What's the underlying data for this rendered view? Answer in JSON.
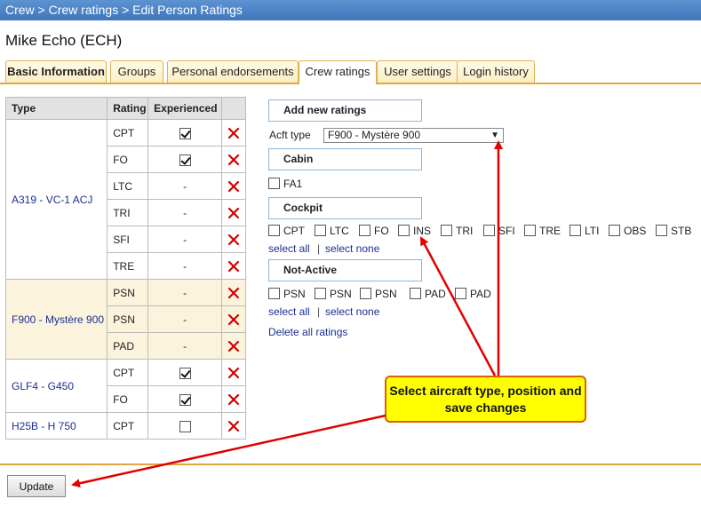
{
  "breadcrumb": "Crew > Crew ratings > Edit Person Ratings",
  "person_name": "Mike Echo (ECH)",
  "tabs": [
    {
      "label": "Basic Information",
      "active": false
    },
    {
      "label": "Groups",
      "active": false
    },
    {
      "label": "Personal endorsements",
      "active": false
    },
    {
      "label": "Crew ratings",
      "active": true
    },
    {
      "label": "User settings",
      "active": false
    },
    {
      "label": "Login history",
      "active": false
    }
  ],
  "ratings_table": {
    "headers": [
      "Type",
      "Rating",
      "Experienced",
      ""
    ],
    "groups": [
      {
        "type": "A319 - VC-1 ACJ",
        "rows": [
          {
            "rating": "CPT",
            "experienced": "checked"
          },
          {
            "rating": "FO",
            "experienced": "checked"
          },
          {
            "rating": "LTC",
            "experienced": "-"
          },
          {
            "rating": "TRI",
            "experienced": "-"
          },
          {
            "rating": "SFI",
            "experienced": "-"
          },
          {
            "rating": "TRE",
            "experienced": "-"
          }
        ]
      },
      {
        "type": "F900 - Mystère 900",
        "rows": [
          {
            "rating": "PSN",
            "experienced": "-"
          },
          {
            "rating": "PSN",
            "experienced": "-"
          },
          {
            "rating": "PAD",
            "experienced": "-"
          }
        ]
      },
      {
        "type": "GLF4 - G450",
        "rows": [
          {
            "rating": "CPT",
            "experienced": "checked"
          },
          {
            "rating": "FO",
            "experienced": "checked"
          }
        ]
      },
      {
        "type": "H25B - H 750",
        "rows": [
          {
            "rating": "CPT",
            "experienced": "unchecked"
          }
        ]
      }
    ],
    "delete_icon": "red-x-icon"
  },
  "panel": {
    "add_new_ratings": "Add new ratings",
    "acft_type_label": "Acft type",
    "acft_type_value": "F900 - Mystère 900",
    "cabin_title": "Cabin",
    "cabin_options": [
      "FA1"
    ],
    "cockpit_title": "Cockpit",
    "cockpit_options": [
      "CPT",
      "LTC",
      "FO",
      "INS",
      "TRI",
      "SFI",
      "TRE",
      "LTI",
      "OBS",
      "STB"
    ],
    "select_all": "select all",
    "select_none": "select none",
    "link_separator": "|",
    "not_active_title": "Not-Active",
    "not_active_options": [
      "PSN",
      "PSN",
      "PSN",
      "PAD",
      "PAD"
    ],
    "delete_all": "Delete all ratings"
  },
  "update_button": "Update",
  "callout_text": "Select aircraft type, position and save changes",
  "colors": {
    "titlebar": "#4a82c8",
    "tab_border": "#e0b050",
    "link": "#1b2f8f",
    "callout_bg": "#ffff00",
    "arrow": "#e00000"
  }
}
